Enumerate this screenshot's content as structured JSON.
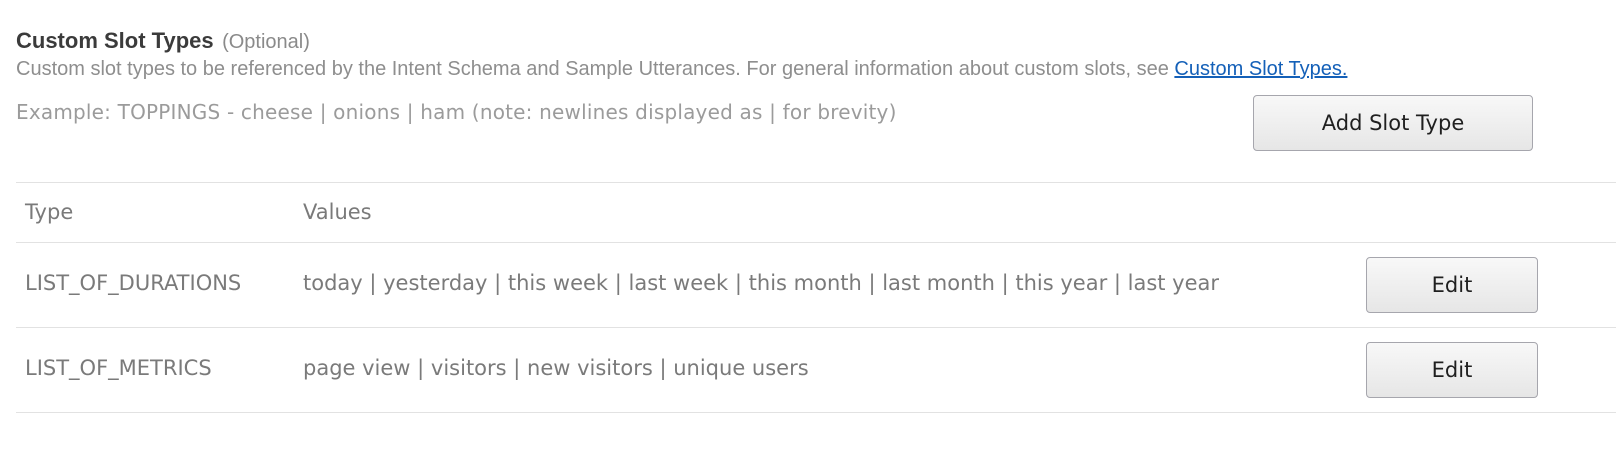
{
  "section": {
    "title": "Custom Slot Types",
    "optional_label": "(Optional)",
    "description_text": "Custom slot types to be referenced by the Intent Schema and Sample Utterances. For general information about custom slots, see ",
    "description_link": "Custom Slot Types.",
    "example": "Example: TOPPINGS - cheese | onions | ham (note: newlines displayed as | for brevity)",
    "add_button_label": "Add Slot Type"
  },
  "table": {
    "headers": {
      "type": "Type",
      "values": "Values"
    },
    "rows": [
      {
        "type": "LIST_OF_DURATIONS",
        "values": "today | yesterday | this week | last week | this month | last month | this year | last year",
        "edit_label": "Edit"
      },
      {
        "type": "LIST_OF_METRICS",
        "values": "page view | visitors | new visitors | unique users",
        "edit_label": "Edit"
      }
    ]
  }
}
